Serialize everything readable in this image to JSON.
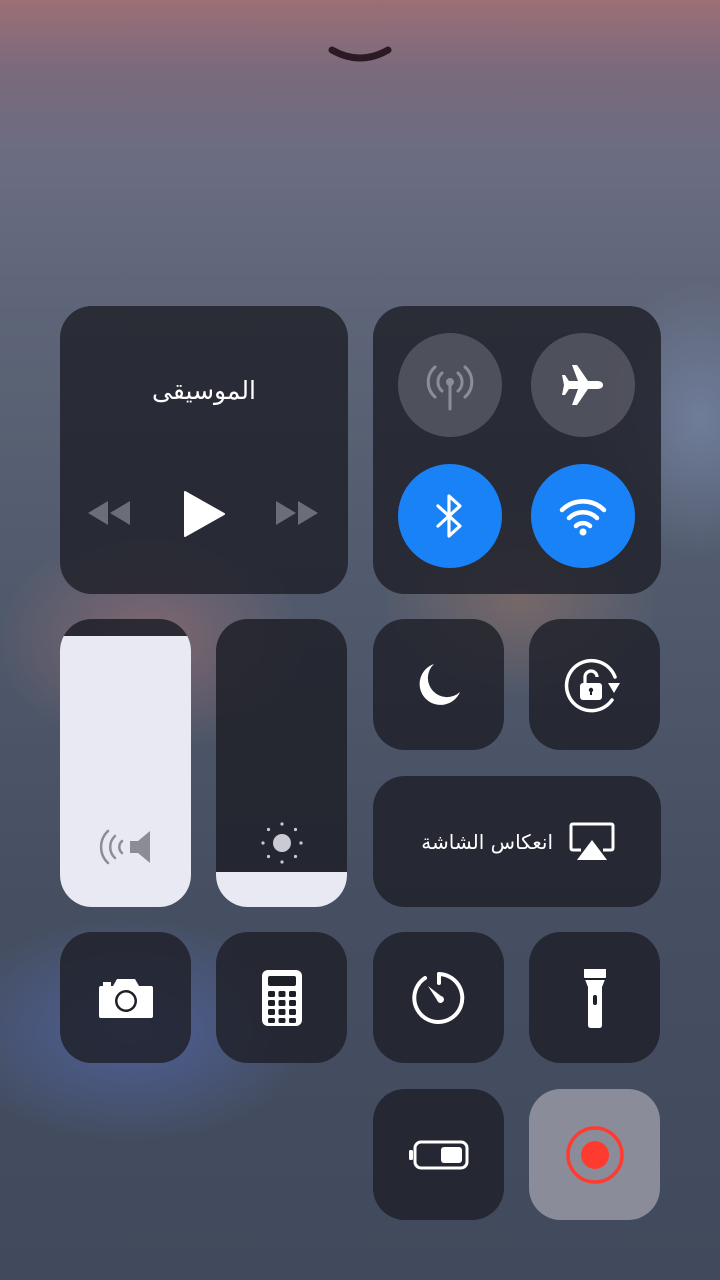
{
  "music": {
    "title": "الموسيقى",
    "controls": [
      "rewind-icon",
      "play-icon",
      "fast-forward-icon"
    ]
  },
  "connectivity": {
    "cellular": {
      "state": "off",
      "icon": "cellular-antenna-icon"
    },
    "airplane": {
      "state": "off",
      "icon": "airplane-icon"
    },
    "bluetooth": {
      "state": "on",
      "icon": "bluetooth-icon"
    },
    "wifi": {
      "state": "on",
      "icon": "wifi-icon"
    }
  },
  "volume": {
    "level": 0.94,
    "icon": "speaker-icon"
  },
  "brightness": {
    "level": 0.12,
    "icon": "sun-icon"
  },
  "do_not_disturb": {
    "icon": "moon-icon"
  },
  "orientation_lock": {
    "icon": "rotation-lock-icon"
  },
  "screen_mirroring": {
    "label": "انعكاس الشاشة",
    "icon": "airplay-icon"
  },
  "shortcuts": [
    "camera-icon",
    "calculator-icon",
    "timer-icon",
    "flashlight-icon",
    "low-power-mode-icon",
    "screen-record-icon"
  ],
  "colors": {
    "accent": "#1a82f7",
    "record": "#ff3b30"
  }
}
